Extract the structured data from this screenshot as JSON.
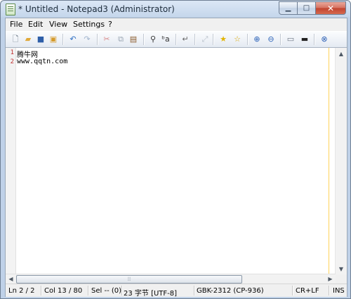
{
  "window": {
    "title": "* Untitled - Notepad3 (Administrator)",
    "controls": {
      "minimize": "▁",
      "maximize": "□",
      "close": "✕"
    }
  },
  "menu": [
    "File",
    "Edit",
    "View",
    "Settings",
    "?"
  ],
  "toolbar": {
    "buttons": [
      {
        "name": "new",
        "icon": "new-document-icon",
        "glyph": "🗋",
        "color": "#5d6b7a"
      },
      {
        "name": "open",
        "icon": "open-folder-icon",
        "glyph": "▰",
        "color": "#e0a93a"
      },
      {
        "name": "save",
        "icon": "save-icon",
        "glyph": "■",
        "color": "#2d5ea8"
      },
      {
        "name": "save-as",
        "icon": "save-as-icon",
        "glyph": "▣",
        "color": "#d59a2a"
      },
      {
        "name": "undo",
        "icon": "undo-icon",
        "glyph": "↶",
        "color": "#2e6fc2"
      },
      {
        "name": "redo",
        "icon": "redo-icon",
        "glyph": "↷",
        "color": "#9fb3cc"
      },
      {
        "name": "cut",
        "icon": "cut-icon",
        "glyph": "✂",
        "color": "#d98b8b"
      },
      {
        "name": "copy",
        "icon": "copy-icon",
        "glyph": "⧉",
        "color": "#9aa6b3"
      },
      {
        "name": "paste",
        "icon": "paste-icon",
        "glyph": "▤",
        "color": "#8a5a2a"
      },
      {
        "name": "find",
        "icon": "binoculars-icon",
        "glyph": "⚲",
        "color": "#333333"
      },
      {
        "name": "replace",
        "icon": "replace-icon",
        "glyph": "ᵇa",
        "color": "#333333"
      },
      {
        "name": "word-wrap",
        "icon": "word-wrap-icon",
        "glyph": "↵",
        "color": "#666666"
      },
      {
        "name": "fullscreen",
        "icon": "fullscreen-icon",
        "glyph": "⤢",
        "color": "#b8c0ca"
      },
      {
        "name": "favorites",
        "icon": "star-icon",
        "glyph": "★",
        "color": "#e2b400"
      },
      {
        "name": "add-favorite",
        "icon": "star-add-icon",
        "glyph": "☆",
        "color": "#d8a800"
      },
      {
        "name": "zoom-in",
        "icon": "zoom-in-icon",
        "glyph": "⊕",
        "color": "#2b62b8"
      },
      {
        "name": "zoom-out",
        "icon": "zoom-out-icon",
        "glyph": "⊖",
        "color": "#2b62b8"
      },
      {
        "name": "schemes",
        "icon": "scheme-icon",
        "glyph": "▭",
        "color": "#6d7784"
      },
      {
        "name": "settings",
        "icon": "monitor-icon",
        "glyph": "▬",
        "color": "#222222"
      },
      {
        "name": "exit",
        "icon": "exit-icon",
        "glyph": "⊗",
        "color": "#2b5fb5"
      }
    ]
  },
  "editor": {
    "lines": [
      {
        "number": "1",
        "text": "腾牛网"
      },
      {
        "number": "2",
        "text": "www.qqtn.com"
      }
    ],
    "scroll_up": "▲",
    "scroll_down": "▼",
    "scroll_left": "◀",
    "scroll_right": "▶",
    "thumb_grip": "⦙⦙⦙"
  },
  "status": {
    "ln": "Ln 2 / 2",
    "col": "Col 13 / 80",
    "sel": "Sel -- (0)",
    "size": "23 字节 [UTF-8]",
    "encoding": "GBK-2312 (CP-936)",
    "eol": "CR+LF",
    "ins": "INS"
  }
}
